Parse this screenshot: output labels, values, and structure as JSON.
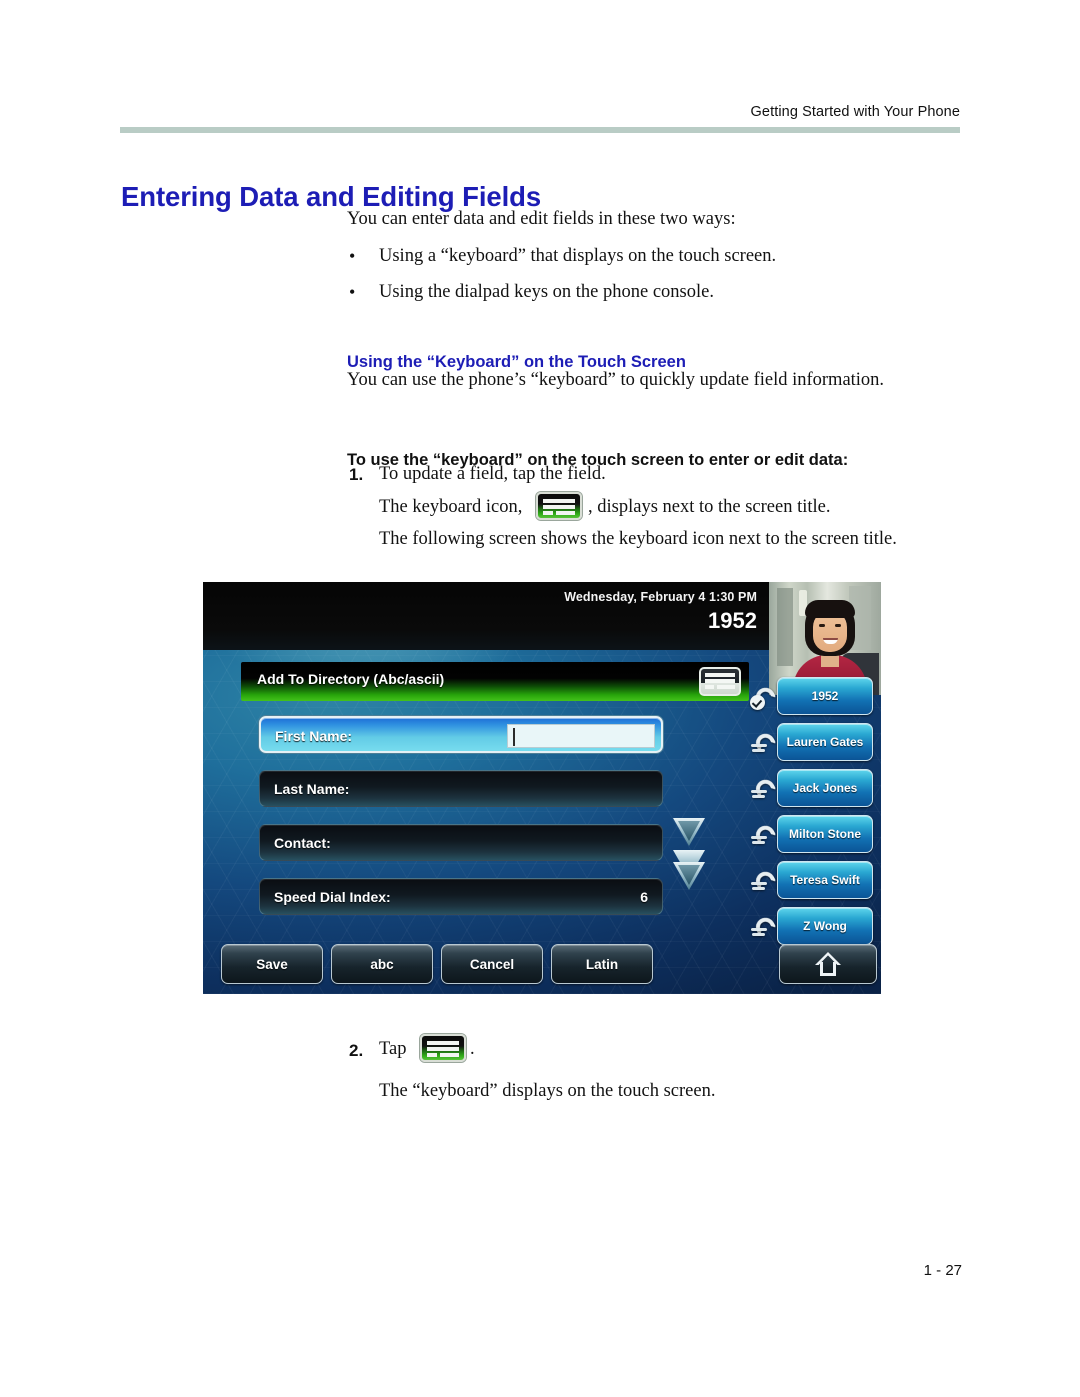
{
  "page": {
    "running_head": "Getting Started with Your Phone",
    "page_number": "1 - 27",
    "heading": "Entering Data and Editing Fields",
    "intro": "You can enter data and edit fields in these two ways:",
    "bullets": [
      "Using a “keyboard” that displays on the touch screen.",
      "Using the dialpad keys on the phone console."
    ],
    "section_heading": "Using the “Keyboard” on the Touch Screen",
    "section_intro": "You can use the phone’s “keyboard” to quickly update field information.",
    "procedure_heading": "To use the “keyboard” on the touch screen to enter or edit data:",
    "steps": [
      {
        "number": "1.",
        "text": "To update a field, tap the field.",
        "sub_pre": "The keyboard icon,",
        "sub_post": ", displays next to the screen title.",
        "note": "The following screen shows the keyboard icon next to the screen title."
      },
      {
        "number": "2.",
        "text_pre": "Tap",
        "text_post": ".",
        "note": "The “keyboard” displays on the touch screen."
      }
    ],
    "colors": {
      "heading_blue": "#1d1db5",
      "rule_sage": "#b9ccc5",
      "body_black": "#121212"
    }
  },
  "phone_screen": {
    "status_bar": {
      "date_time": "Wednesday, February 4  1:30 PM",
      "extension": "1952"
    },
    "title_bar": {
      "title": "Add To Directory (Abc/ascii)",
      "icon": "keyboard-icon"
    },
    "fields": [
      {
        "label": "First Name:",
        "value": "",
        "selected": true
      },
      {
        "label": "Last Name:",
        "value": "",
        "selected": false
      },
      {
        "label": "Contact:",
        "value": "",
        "selected": false
      },
      {
        "label": "Speed Dial Index:",
        "value": "6",
        "selected": false
      }
    ],
    "scroll_indicators": [
      "down-arrow-icon",
      "double-down-arrow-icon"
    ],
    "line_keys": [
      {
        "label": "1952",
        "icon": "handset-check-icon"
      },
      {
        "label": "Lauren Gates",
        "icon": "handset-icon"
      },
      {
        "label": "Jack Jones",
        "icon": "handset-icon"
      },
      {
        "label": "Milton Stone",
        "icon": "handset-icon"
      },
      {
        "label": "Teresa Swift",
        "icon": "handset-icon"
      },
      {
        "label": "Z Wong",
        "icon": "handset-icon"
      }
    ],
    "soft_keys": [
      "Save",
      "abc",
      "Cancel",
      "Latin"
    ],
    "home_key": "home-icon",
    "video_thumbnail": "user-video-thumbnail"
  }
}
